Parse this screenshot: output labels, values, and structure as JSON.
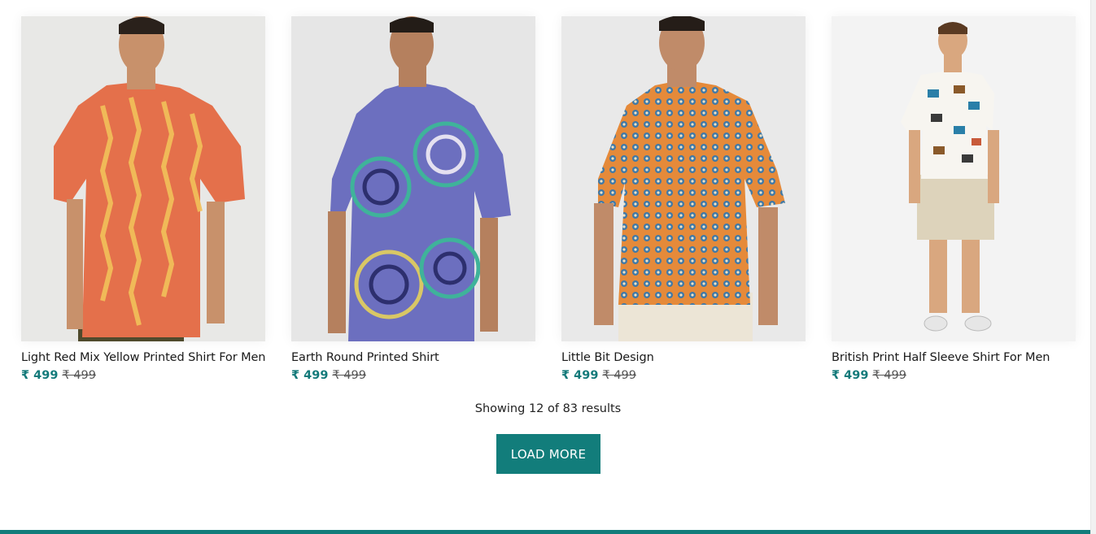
{
  "products": [
    {
      "name": "Light Red Mix Yellow Printed Shirt For Men",
      "price": "₹ 499",
      "mrp": "₹ 499",
      "image_icon": "model-orange-ikat-shirt"
    },
    {
      "name": "Earth Round Printed Shirt",
      "price": "₹ 499",
      "mrp": "₹ 499",
      "image_icon": "model-tie-dye-shirt"
    },
    {
      "name": "Little Bit Design",
      "price": "₹ 499",
      "mrp": "₹ 499",
      "image_icon": "model-orange-pattern-shirt"
    },
    {
      "name": "British Print Half Sleeve Shirt For Men",
      "price": "₹ 499",
      "mrp": "₹ 499",
      "image_icon": "model-white-print-shirt"
    }
  ],
  "pagination": {
    "results_text": "Showing 12 of 83 results",
    "load_more_label": "LOAD MORE"
  },
  "colors": {
    "accent": "#127d7b",
    "price": "#137a7a"
  }
}
